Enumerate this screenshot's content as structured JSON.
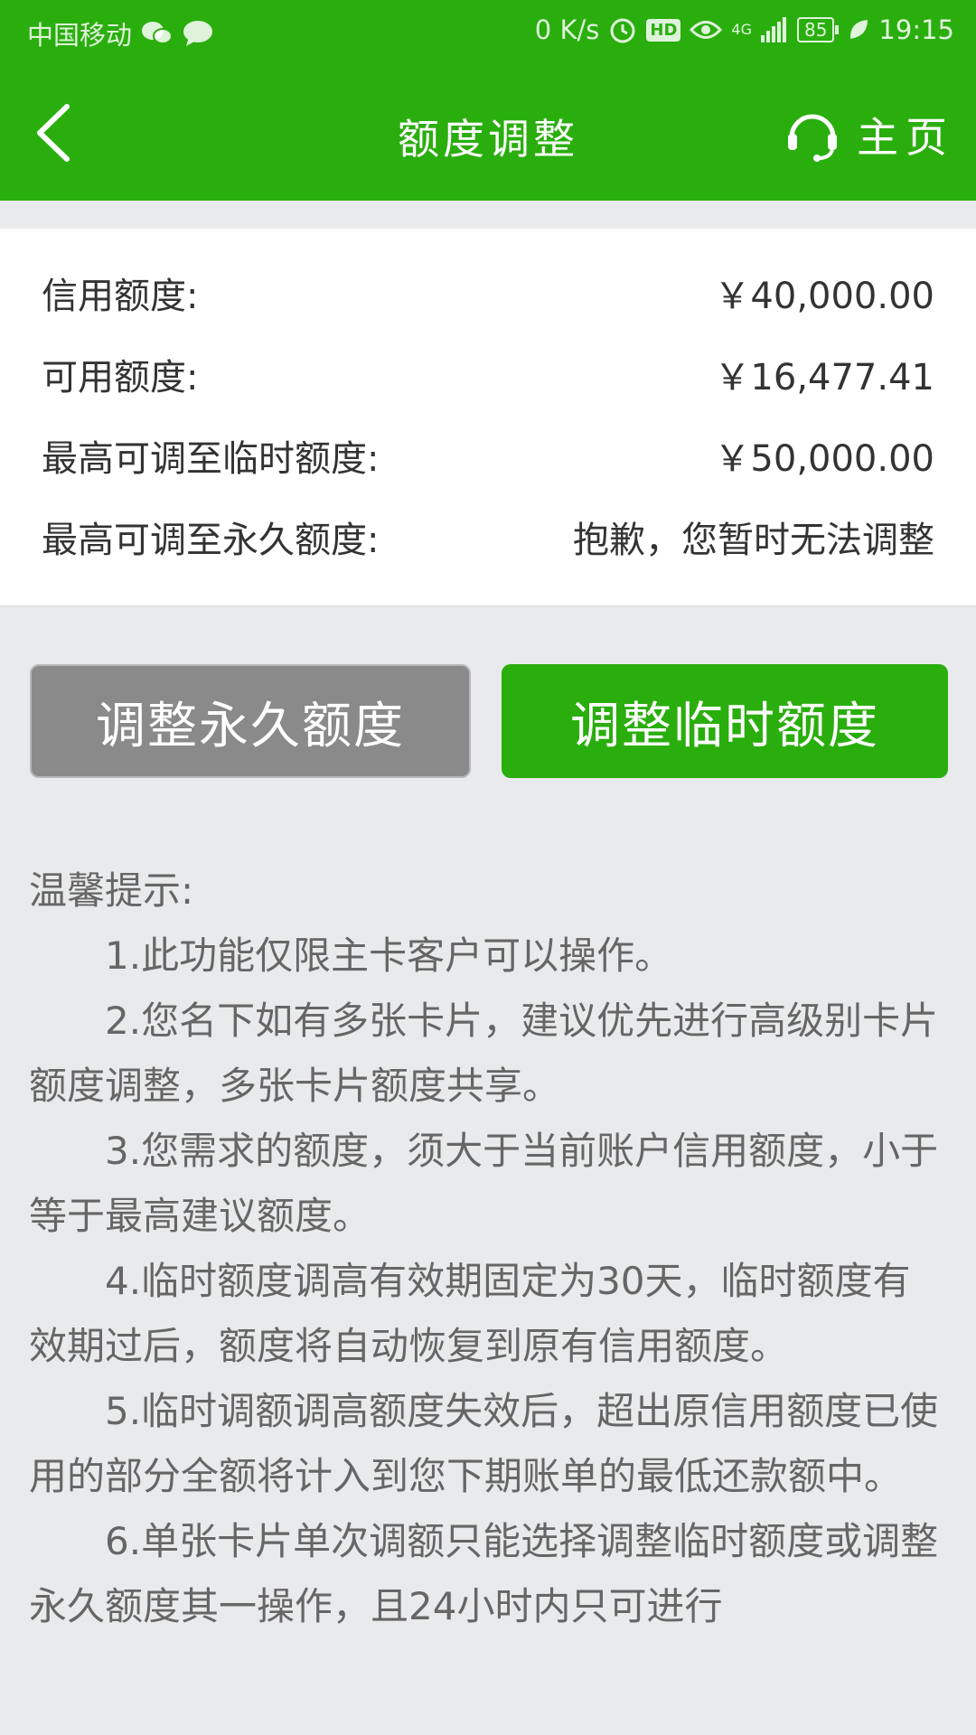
{
  "status_bar": {
    "carrier": "中国移动",
    "speed": "0 K/s",
    "network": "4G",
    "battery": "85",
    "time": "19:15",
    "icons": [
      "wechat-icon",
      "message-icon",
      "alarm-icon",
      "hd-icon",
      "eye-icon",
      "signal-icon",
      "battery-icon",
      "leaf-icon"
    ]
  },
  "nav": {
    "title": "额度调整",
    "home_label": "主页"
  },
  "info": {
    "rows": [
      {
        "label": "信用额度:",
        "value": "￥40,000.00"
      },
      {
        "label": "可用额度:",
        "value": "￥16,477.41"
      },
      {
        "label": "最高可调至临时额度:",
        "value": "￥50,000.00"
      },
      {
        "label": "最高可调至永久额度:",
        "value": "抱歉，您暂时无法调整"
      }
    ]
  },
  "buttons": {
    "permanent": "调整永久额度",
    "temporary": "调整临时额度"
  },
  "tips": {
    "title": "温馨提示:",
    "items": [
      "1.此功能仅限主卡客户可以操作。",
      "2.您名下如有多张卡片，建议优先进行高级别卡片额度调整，多张卡片额度共享。",
      "3.您需求的额度，须大于当前账户信用额度，小于等于最高建议额度。",
      "4.临时额度调高有效期固定为30天，临时额度有效期过后，额度将自动恢复到原有信用额度。",
      "5.临时调额调高额度失效后，超出原信用额度已使用的部分全额将计入到您下期账单的最低还款额中。",
      "6.单张卡片单次调额只能选择调整临时额度或调整永久额度其一操作，且24小时内只可进行"
    ]
  },
  "colors": {
    "primary": "#2aae0e",
    "disabled_button": "#8a8a8a",
    "background": "#e9eaeb"
  }
}
